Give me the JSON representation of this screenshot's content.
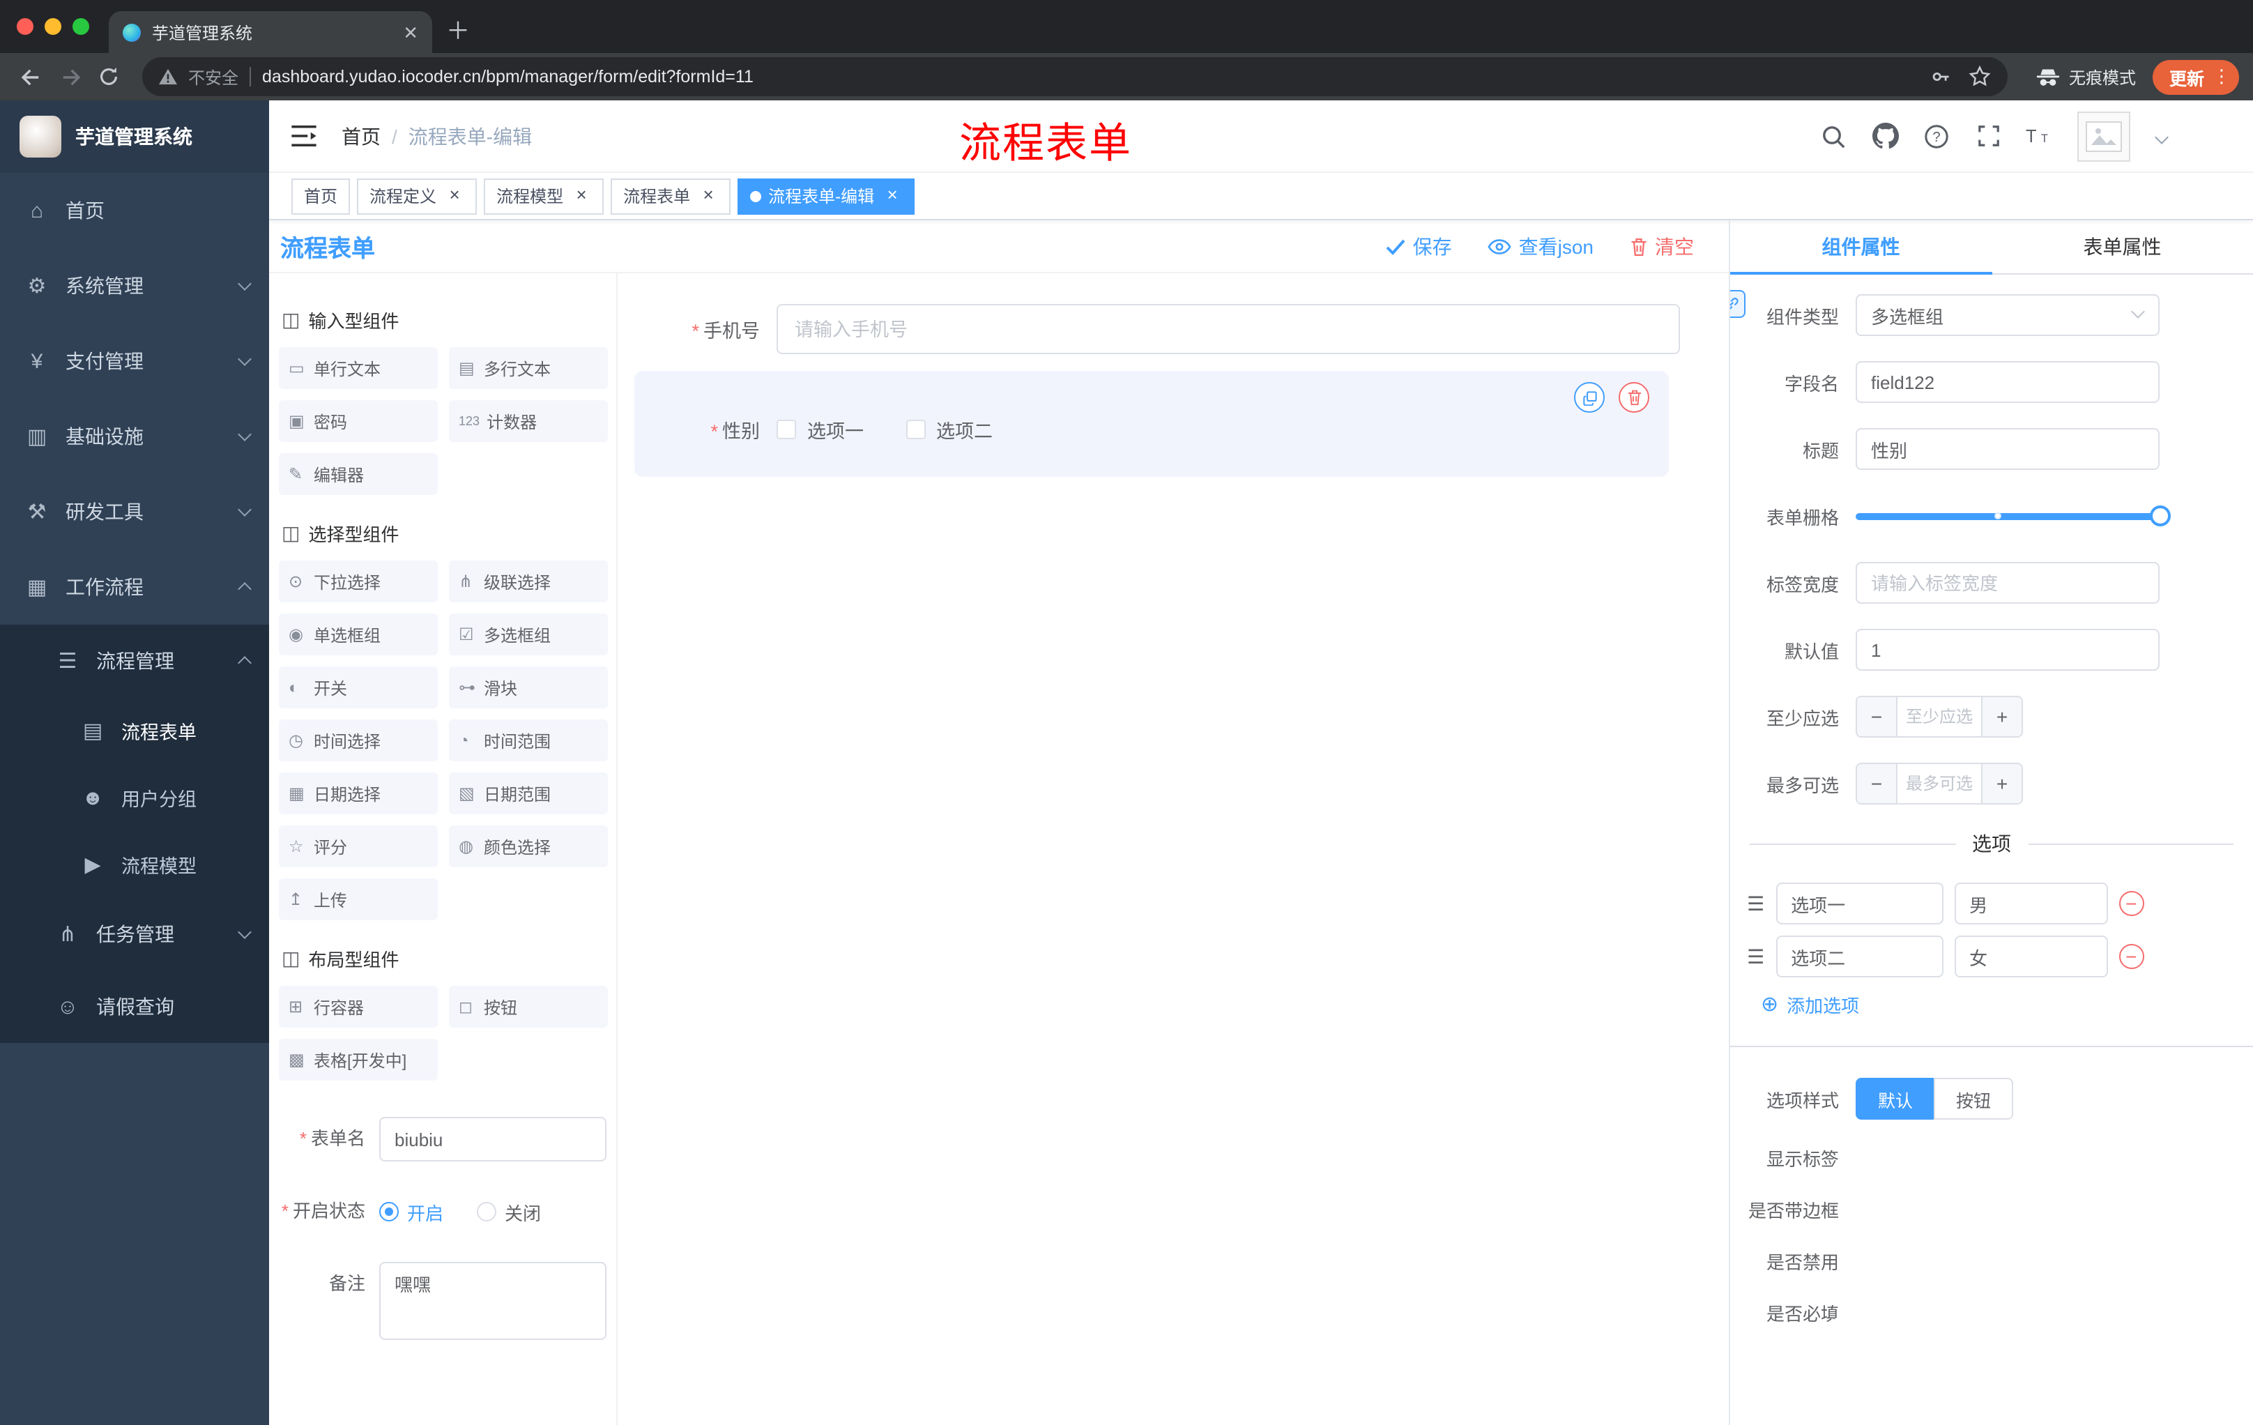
{
  "browser": {
    "tab_title": "芋道管理系统",
    "security_label": "不安全",
    "url": "dashboard.yudao.iocoder.cn/bpm/manager/form/edit?formId=11",
    "incognito_label": "无痕模式",
    "update_label": "更新"
  },
  "sidebar": {
    "logo_title": "芋道管理系统",
    "menu": [
      {
        "label": "首页",
        "icon": "home-icon"
      },
      {
        "label": "系统管理",
        "icon": "gear-icon"
      },
      {
        "label": "支付管理",
        "icon": "yen-icon"
      },
      {
        "label": "基础设施",
        "icon": "infrastructure-icon"
      },
      {
        "label": "研发工具",
        "icon": "tools-icon"
      },
      {
        "label": "工作流程",
        "icon": "workflow-icon"
      }
    ],
    "submenu": [
      {
        "label": "流程管理",
        "icon": "list-icon"
      },
      {
        "label": "流程表单",
        "icon": "document-icon"
      },
      {
        "label": "用户分组",
        "icon": "users-icon"
      },
      {
        "label": "流程模型",
        "icon": "send-icon"
      },
      {
        "label": "任务管理",
        "icon": "tree-icon"
      },
      {
        "label": "请假查询",
        "icon": "person-icon"
      }
    ]
  },
  "header": {
    "breadcrumb_home": "首页",
    "breadcrumb_separator": "/",
    "breadcrumb_current": "流程表单-编辑",
    "annotation": "流程表单"
  },
  "tags": [
    {
      "label": "首页"
    },
    {
      "label": "流程定义"
    },
    {
      "label": "流程模型"
    },
    {
      "label": "流程表单"
    },
    {
      "label": "流程表单-编辑"
    }
  ],
  "editor": {
    "title": "流程表单",
    "save_label": "保存",
    "view_json_label": "查看json",
    "clear_label": "清空"
  },
  "components": {
    "groups": [
      {
        "title": "输入型组件",
        "items": [
          {
            "label": "单行文本",
            "icon": "single-line-text-icon"
          },
          {
            "label": "多行文本",
            "icon": "multi-line-text-icon"
          },
          {
            "label": "密码",
            "icon": "password-icon"
          },
          {
            "label": "计数器",
            "icon": "counter-icon"
          },
          {
            "label": "编辑器",
            "icon": "editor-icon"
          }
        ]
      },
      {
        "title": "选择型组件",
        "items": [
          {
            "label": "下拉选择",
            "icon": "select-icon"
          },
          {
            "label": "级联选择",
            "icon": "cascader-icon"
          },
          {
            "label": "单选框组",
            "icon": "radio-group-icon"
          },
          {
            "label": "多选框组",
            "icon": "checkbox-group-icon"
          },
          {
            "label": "开关",
            "icon": "switch-icon"
          },
          {
            "label": "滑块",
            "icon": "slider-icon"
          },
          {
            "label": "时间选择",
            "icon": "time-icon"
          },
          {
            "label": "时间范围",
            "icon": "time-range-icon"
          },
          {
            "label": "日期选择",
            "icon": "date-icon"
          },
          {
            "label": "日期范围",
            "icon": "date-range-icon"
          },
          {
            "label": "评分",
            "icon": "rating-icon"
          },
          {
            "label": "颜色选择",
            "icon": "color-icon"
          },
          {
            "label": "上传",
            "icon": "upload-icon"
          }
        ]
      },
      {
        "title": "布局型组件",
        "items": [
          {
            "label": "行容器",
            "icon": "row-container-icon"
          },
          {
            "label": "按钮",
            "icon": "button-icon"
          },
          {
            "label": "表格[开发中]",
            "icon": "table-icon"
          }
        ]
      }
    ],
    "form": {
      "name_label": "表单名",
      "name_value": "biubiu",
      "status_label": "开启状态",
      "status_on": "开启",
      "status_off": "关闭",
      "remark_label": "备注",
      "remark_value": "嘿嘿"
    }
  },
  "canvas": {
    "phone_label": "手机号",
    "phone_placeholder": "请输入手机号",
    "gender_label": "性别",
    "gender_options": [
      "选项一",
      "选项二"
    ]
  },
  "props": {
    "tab_component": "组件属性",
    "tab_form": "表单属性",
    "rows": {
      "type_label": "组件类型",
      "type_value": "多选框组",
      "field_label": "字段名",
      "field_value": "field122",
      "title_label": "标题",
      "title_value": "性别",
      "grid_label": "表单栅格",
      "label_width_label": "标签宽度",
      "label_width_placeholder": "请输入标签宽度",
      "default_label": "默认值",
      "default_value": "1",
      "min_label": "至少应选",
      "min_placeholder": "至少应选",
      "max_label": "最多可选",
      "max_placeholder": "最多可选"
    },
    "options_title": "选项",
    "options": [
      {
        "label": "选项一",
        "value": "男"
      },
      {
        "label": "选项二",
        "value": "女"
      }
    ],
    "add_option_label": "添加选项",
    "style_label": "选项样式",
    "style_default": "默认",
    "style_button": "按钮",
    "toggle_show_label": "显示标签",
    "toggle_border": "是否带边框",
    "toggle_disabled": "是否禁用",
    "toggle_required": "是否必填"
  },
  "colors": {
    "primary": "#409eff",
    "danger": "#f56c6c",
    "sidebar_bg": "#304156",
    "submenu_bg": "#1f2d3d",
    "annotation": "#fe0000",
    "update_pill": "#e8623a",
    "active_tag": "#409eff"
  }
}
